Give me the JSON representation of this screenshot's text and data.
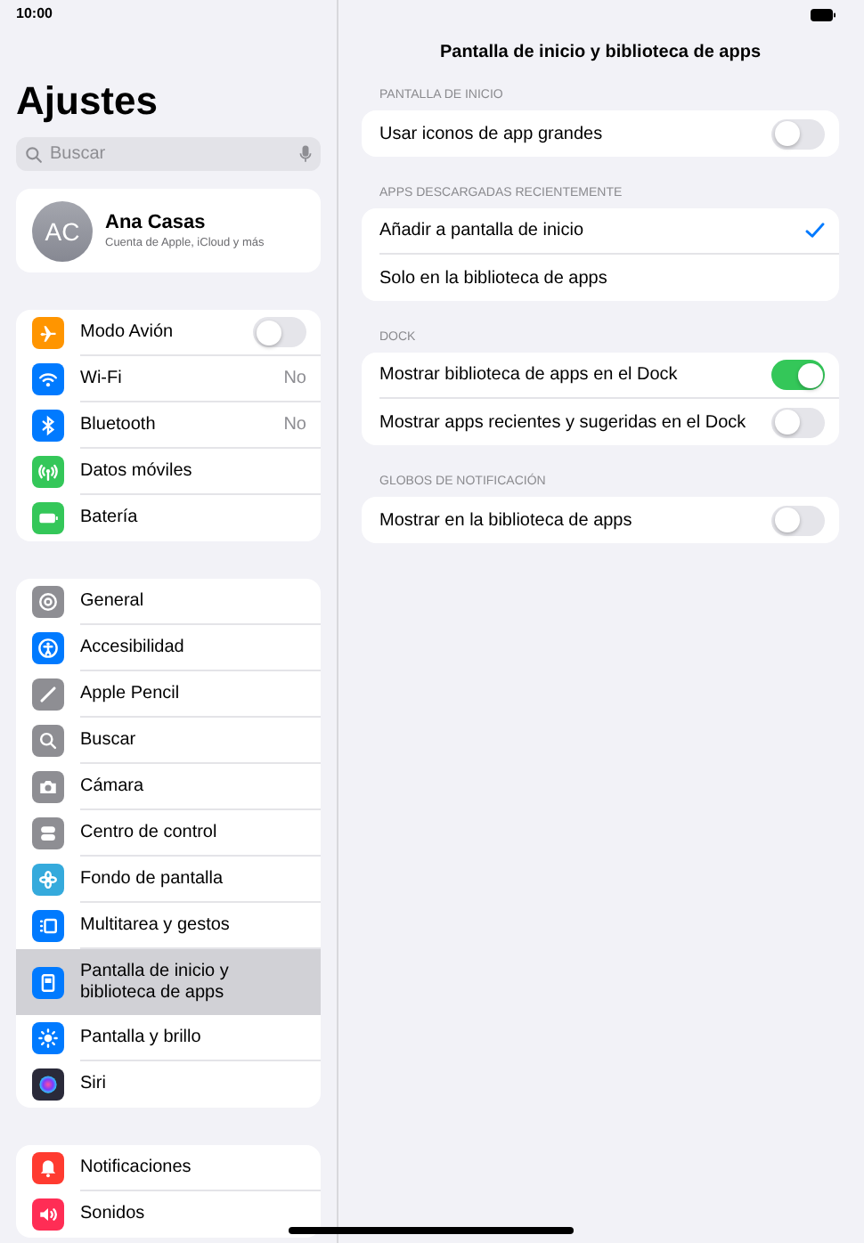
{
  "status_bar": {
    "time": "10:00"
  },
  "sidebar": {
    "title": "Ajustes",
    "search": {
      "placeholder": "Buscar"
    },
    "profile": {
      "initials": "AC",
      "name": "Ana Casas",
      "subtitle": "Cuenta de Apple, iCloud y más"
    },
    "groups": [
      {
        "items": [
          {
            "label": "Modo Avión",
            "color": "#ff9500",
            "kind": "toggle",
            "on": false,
            "selected": false
          },
          {
            "label": "Wi-Fi",
            "color": "#007aff",
            "kind": "value",
            "value": "No",
            "selected": false
          },
          {
            "label": "Bluetooth",
            "color": "#007aff",
            "kind": "value",
            "value": "No",
            "selected": false
          },
          {
            "label": "Datos móviles",
            "color": "#34c759",
            "kind": "nav",
            "selected": false
          },
          {
            "label": "Batería",
            "color": "#34c759",
            "kind": "nav",
            "selected": false
          }
        ]
      },
      {
        "items": [
          {
            "label": "General",
            "color": "#8e8e93",
            "kind": "nav",
            "selected": false
          },
          {
            "label": "Accesibilidad",
            "color": "#007aff",
            "kind": "nav",
            "selected": false
          },
          {
            "label": "Apple Pencil",
            "color": "#8e8e93",
            "kind": "nav",
            "selected": false
          },
          {
            "label": "Buscar",
            "color": "#8e8e93",
            "kind": "nav",
            "selected": false
          },
          {
            "label": "Cámara",
            "color": "#8e8e93",
            "kind": "nav",
            "selected": false
          },
          {
            "label": "Centro de control",
            "color": "#8e8e93",
            "kind": "nav",
            "selected": false
          },
          {
            "label": "Fondo de pantalla",
            "color": "#35aadc",
            "kind": "nav",
            "selected": false
          },
          {
            "label": "Multitarea y gestos",
            "color": "#007aff",
            "kind": "nav",
            "selected": false
          },
          {
            "label": "Pantalla de inicio y biblioteca de apps",
            "color": "#007aff",
            "kind": "nav",
            "selected": true
          },
          {
            "label": "Pantalla y brillo",
            "color": "#007aff",
            "kind": "nav",
            "selected": false
          },
          {
            "label": "Siri",
            "color": "#2a2a3a",
            "kind": "nav",
            "selected": false
          }
        ]
      },
      {
        "items": [
          {
            "label": "Notificaciones",
            "color": "#ff3b30",
            "kind": "nav",
            "selected": false
          },
          {
            "label": "Sonidos",
            "color": "#ff2d55",
            "kind": "nav",
            "selected": false
          }
        ]
      }
    ]
  },
  "detail": {
    "title": "Pantalla de inicio y biblioteca de apps",
    "sections": [
      {
        "header": "PANTALLA DE INICIO",
        "rows": [
          {
            "label": "Usar iconos de app grandes",
            "kind": "toggle",
            "on": false
          }
        ]
      },
      {
        "header": "APPS DESCARGADAS RECIENTEMENTE",
        "rows": [
          {
            "label": "Añadir a pantalla de inicio",
            "kind": "check",
            "selected": true
          },
          {
            "label": "Solo en la biblioteca de apps",
            "kind": "check",
            "selected": false
          }
        ]
      },
      {
        "header": "DOCK",
        "rows": [
          {
            "label": "Mostrar biblioteca de apps en el Dock",
            "kind": "toggle",
            "on": true
          },
          {
            "label": "Mostrar apps recientes y sugeridas en el Dock",
            "kind": "toggle",
            "on": false
          }
        ]
      },
      {
        "header": "GLOBOS DE NOTIFICACIÓN",
        "rows": [
          {
            "label": "Mostrar en la biblioteca de apps",
            "kind": "toggle",
            "on": false
          }
        ]
      }
    ]
  }
}
